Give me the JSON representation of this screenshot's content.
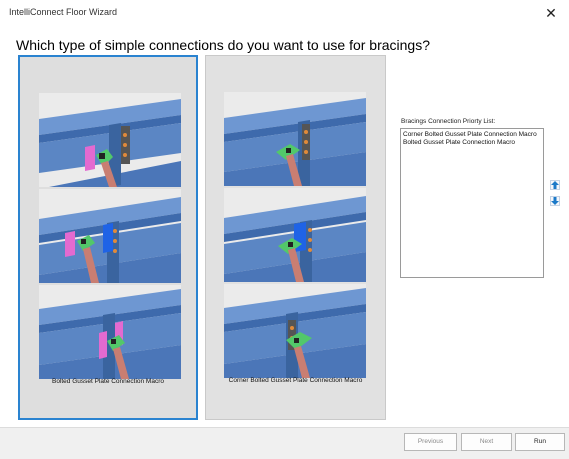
{
  "window": {
    "title": "IntelliConnect Floor Wizard",
    "close_symbol": "✕"
  },
  "heading": "Which type of simple connections do you want to use for bracings?",
  "options": [
    {
      "caption": "Bolted Gusset Plate Connection Macro",
      "selected": true
    },
    {
      "caption": "Corner Bolted Gusset Plate Connection Macro",
      "selected": false
    }
  ],
  "priority_list": {
    "label": "Bracings Connection Priorty List:",
    "items": [
      "Corner Bolted Gusset Plate Connection Macro",
      "Bolted Gusset Plate Connection Macro"
    ]
  },
  "reorder": {
    "up_icon": "arrow-up-icon",
    "down_icon": "arrow-down-icon"
  },
  "footer": {
    "previous_label": "Previous",
    "next_label": "Next",
    "run_label": "Run"
  },
  "colors": {
    "selection_border": "#2a83d0",
    "steel_blue": "#5b86c4",
    "gusset_green": "#52c86a",
    "brace_salmon": "#c97e72",
    "end_plate_pink": "#e36ad0",
    "end_plate_blue": "#1f63e6"
  }
}
